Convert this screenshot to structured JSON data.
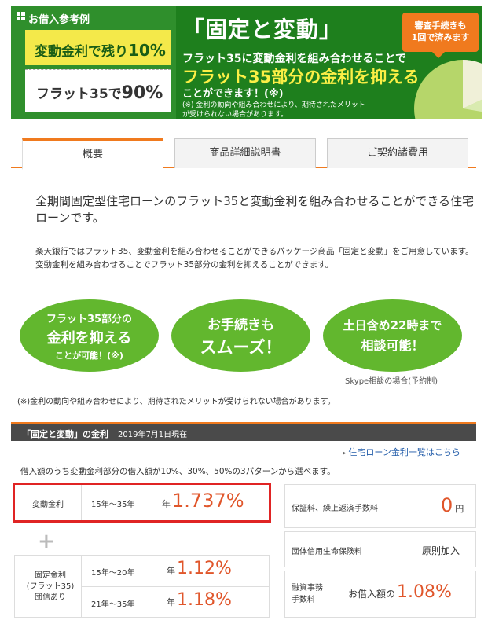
{
  "banner": {
    "example_title": "お借入参考例",
    "box1_text": "変動金利で残り",
    "box1_value": "10%",
    "box2_text": "フラット35で",
    "box2_value": "90%",
    "hero_title": "「固定と変動」",
    "hero_sub1": "フラット35に変動金利を組み合わせることで",
    "hero_sub2": "フラット35部分の金利を抑える",
    "hero_sub3": "ことができます！(※)",
    "hero_note": "(※) 金利の動向や組み合わせにより、期待されたメリットが受けられない場合があります。",
    "tag_line1": "審査手続きも",
    "tag_line2": "1回で済みます",
    "accent": "#f07a1e",
    "green": "#1e7f1d"
  },
  "tabs": [
    {
      "label": "概要",
      "active": true
    },
    {
      "label": "商品詳細説明書",
      "active": false
    },
    {
      "label": "ご契約諸費用",
      "active": false
    }
  ],
  "intro": {
    "lead": "全期間固定型住宅ローンのフラット35と変動金利を組み合わせることができる住宅ローンです。",
    "desc": "楽天銀行ではフラット35、変動金利を組み合わせることができるパッケージ商品「固定と変動」をご用意しています。変動金利を組み合わせることでフラット35部分の金利を抑えることができます。"
  },
  "features": [
    {
      "l1": "フラット35部分の",
      "l2": "金利を抑える",
      "l3": "ことが可能！(※)"
    },
    {
      "l1": "お手続きも",
      "l2": "スムーズ！",
      "l3": ""
    },
    {
      "l1": "土日含め22時まで",
      "l2": "相談可能！",
      "l3": ""
    }
  ],
  "skype_note": "Skype相談の場合(予約制)",
  "caution": "(※)金利の動向や組み合わせにより、期待されたメリットが受けられない場合があります。",
  "rates": {
    "header": "「固定と変動」の金利",
    "date": "2019年7月1日現在",
    "link": "住宅ローン金利一覧はこちら",
    "desc": "借入額のうち変動金利部分の借入額が10%、30%、50%の3パターンから選べます。",
    "variable": {
      "label": "変動金利",
      "term": "15年～35年",
      "prefix": "年",
      "value": "1.737%"
    },
    "fixed": {
      "label1": "固定金利",
      "label2": "(フラット35)",
      "label3": "団信あり",
      "rows": [
        {
          "term": "15年～20年",
          "prefix": "年",
          "value": "1.12%"
        },
        {
          "term": "21年～35年",
          "prefix": "年",
          "value": "1.18%"
        }
      ]
    },
    "fees": [
      {
        "label": "保証料、繰上返済手数料",
        "value": "0",
        "unit": "円"
      },
      {
        "label": "団体信用生命保険料",
        "value": "原則加入"
      },
      {
        "label1": "融資事務",
        "label2": "手数料",
        "prefix": "お借入額の",
        "value": "1.08%"
      }
    ]
  }
}
